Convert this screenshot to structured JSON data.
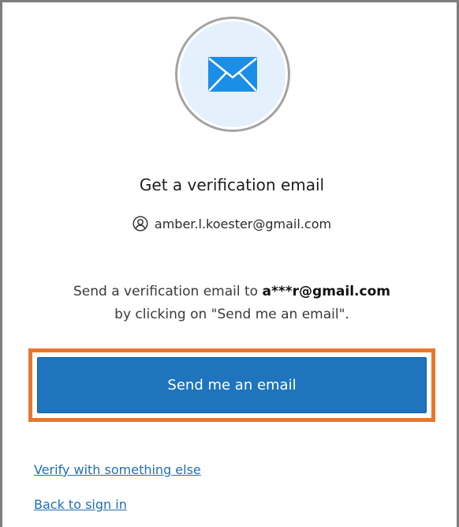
{
  "icons": {
    "envelope": "envelope-icon",
    "user": "user-icon"
  },
  "colors": {
    "primary_button": "#1f74bd",
    "highlight_border": "#e8772e",
    "link": "#1f6fb5",
    "icon_blue": "#1b8ee8",
    "icon_circle_bg": "#e4f1fc"
  },
  "header": {
    "title": "Get a verification email"
  },
  "identifier": {
    "email": "amber.l.koester@gmail.com"
  },
  "instructions": {
    "prefix": "Send a verification email to ",
    "masked_email": "a***r@gmail.com",
    "line2": "by clicking on \"Send me an email\"."
  },
  "actions": {
    "send_label": "Send me an email"
  },
  "links": {
    "verify_else": "Verify with something else",
    "back_to_sign_in": "Back to sign in"
  }
}
